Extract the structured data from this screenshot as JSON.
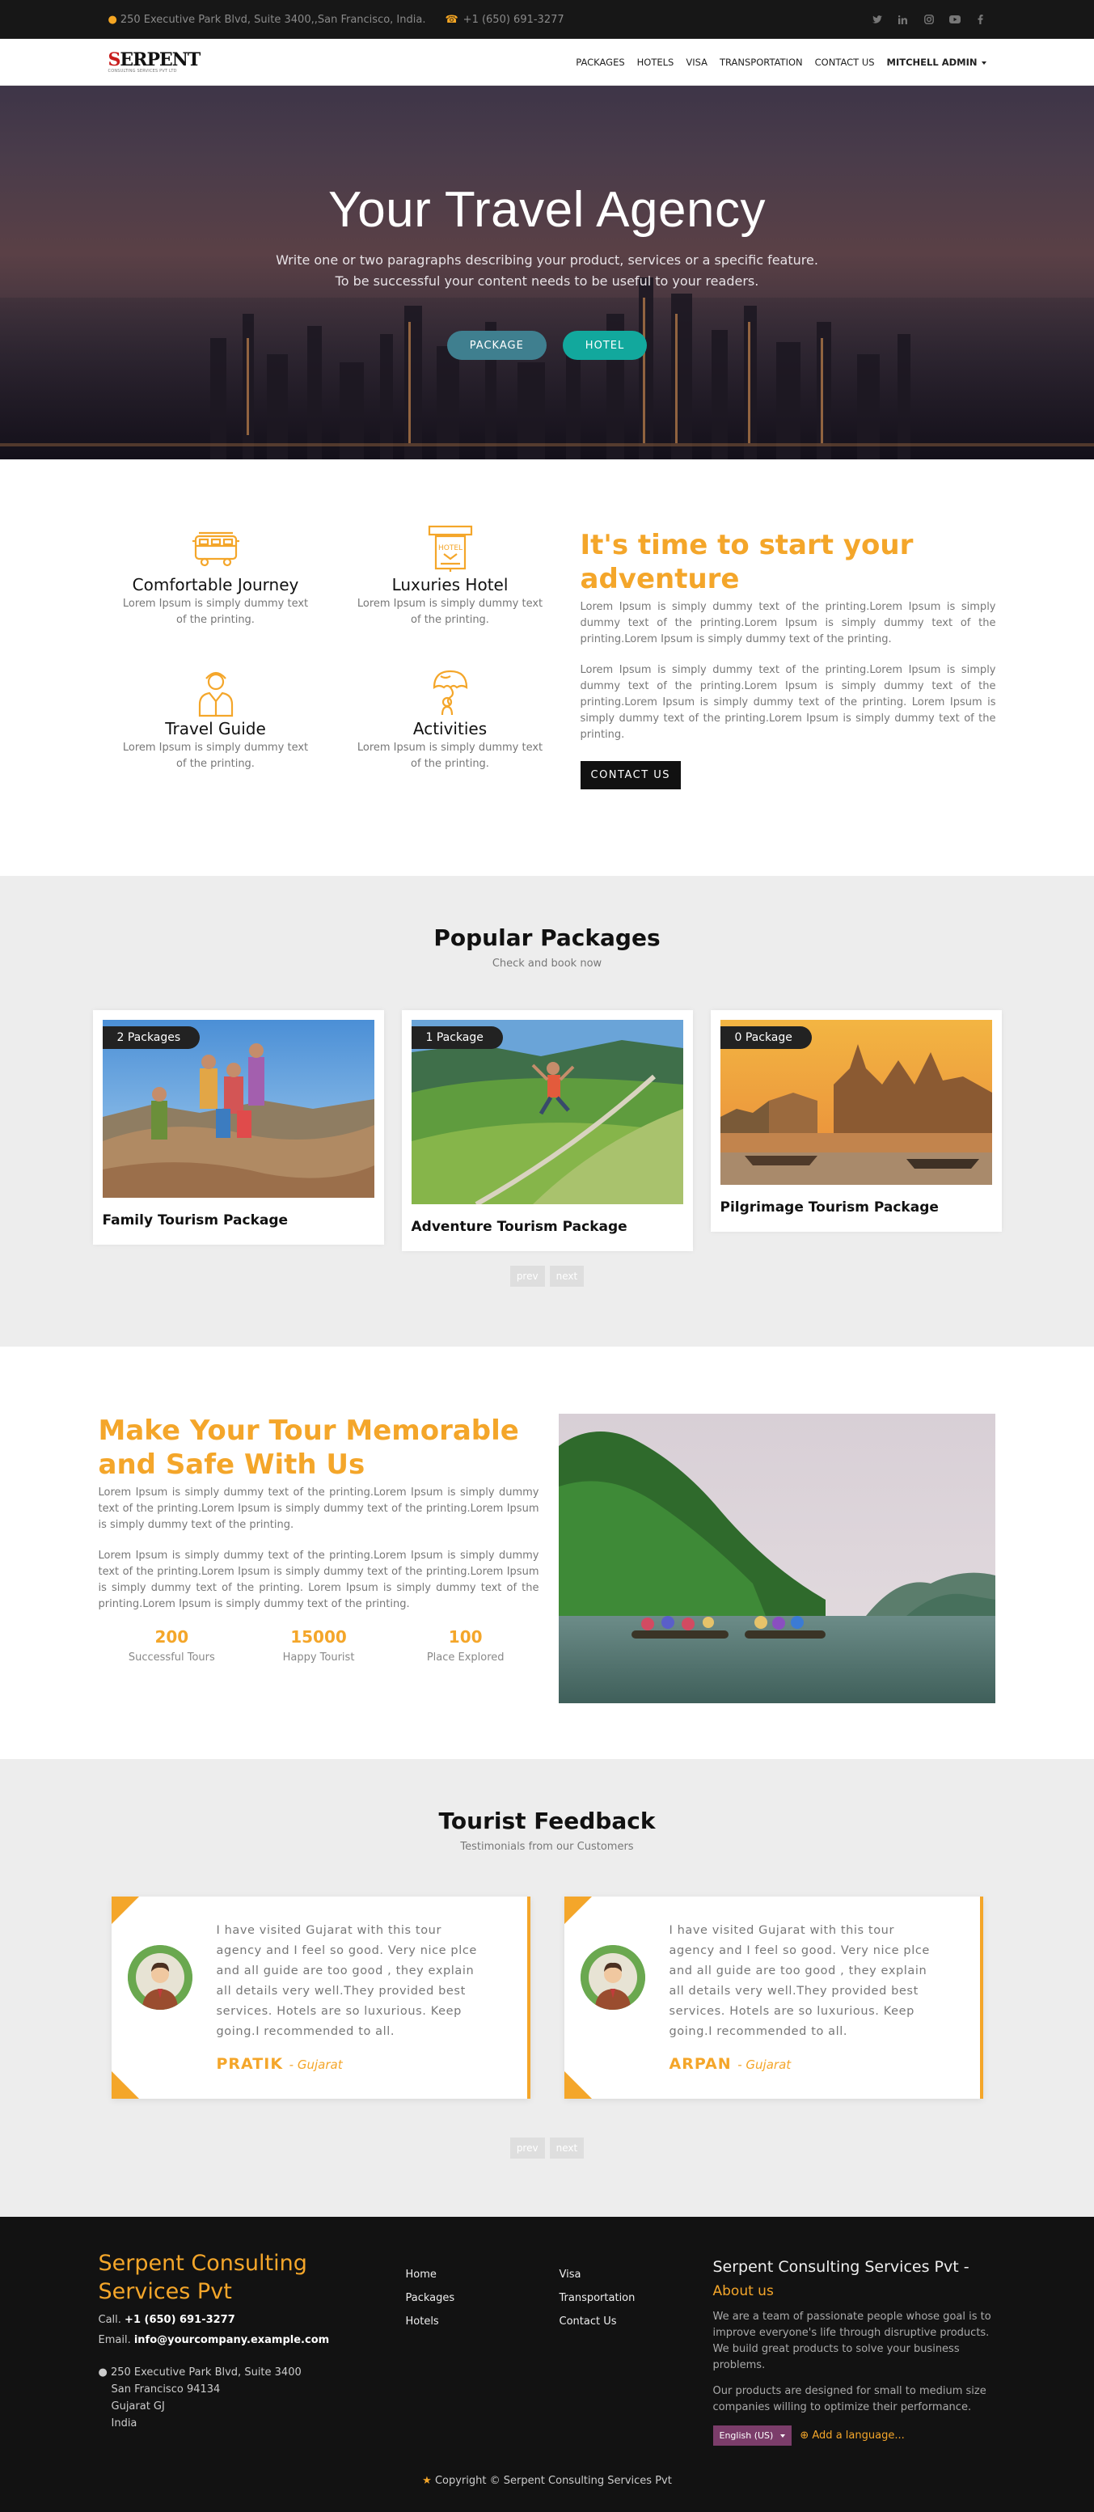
{
  "topbar": {
    "address": "250 Executive Park Blvd, Suite 3400,,San Francisco, India.",
    "phone": "+1 (650) 691-3277"
  },
  "navbar": {
    "logo_text": "SERPENT",
    "logo_sub": "CONSULTING SERVICES PVT LTD",
    "items": [
      "PACKAGES",
      "HOTELS",
      "VISA",
      "TRANSPORTATION",
      "CONTACT US"
    ],
    "user": "MITCHELL ADMIN"
  },
  "hero": {
    "title": "Your Travel Agency",
    "line1": "Write one or two paragraphs describing your product, services or a specific feature.",
    "line2": "To be successful your content needs to be useful to your readers.",
    "btn_package": "PACKAGE",
    "btn_hotel": "HOTEL"
  },
  "features": [
    {
      "title": "Comfortable Journey",
      "desc": "Lorem Ipsum is simply dummy text of the printing.",
      "icon": "bus-icon"
    },
    {
      "title": "Luxuries Hotel",
      "desc": "Lorem Ipsum is simply dummy text of the printing.",
      "icon": "hotel-icon"
    },
    {
      "title": "Travel Guide",
      "desc": "Lorem Ipsum is simply dummy text of the printing.",
      "icon": "guide-icon"
    },
    {
      "title": "Activities",
      "desc": "Lorem Ipsum is simply dummy text of the printing.",
      "icon": "balloon-icon"
    }
  ],
  "adventure": {
    "title": "It's time to start your adventure",
    "p1": "Lorem Ipsum is simply dummy text of the printing.Lorem Ipsum is simply dummy text of the printing.Lorem Ipsum is simply dummy text of the printing.Lorem Ipsum is simply dummy text of the printing.",
    "p2": "Lorem Ipsum is simply dummy text of the printing.Lorem Ipsum is simply dummy text of the printing.Lorem Ipsum is simply dummy text of the printing.Lorem Ipsum is simply dummy text of the printing. Lorem Ipsum is simply dummy text of the printing.Lorem Ipsum is simply dummy text of the printing.",
    "button": "CONTACT US"
  },
  "packages": {
    "title": "Popular Packages",
    "subtitle": "Check and book now",
    "items": [
      {
        "badge": "2 Packages",
        "name": "Family Tourism Package"
      },
      {
        "badge": "1 Package",
        "name": "Adventure Tourism Package"
      },
      {
        "badge": "0 Package",
        "name": "Pilgrimage Tourism Package"
      }
    ],
    "prev": "prev",
    "next": "next"
  },
  "memorable": {
    "title": "Make Your Tour Memorable and Safe With Us",
    "p1": "Lorem Ipsum is simply dummy text of the printing.Lorem Ipsum is simply dummy text of the printing.Lorem Ipsum is simply dummy text of the printing.Lorem Ipsum is simply dummy text of the printing.",
    "p2": "Lorem Ipsum is simply dummy text of the printing.Lorem Ipsum is simply dummy text of the printing.Lorem Ipsum is simply dummy text of the printing.Lorem Ipsum is simply dummy text of the printing. Lorem Ipsum is simply dummy text of the printing.Lorem Ipsum is simply dummy text of the printing.",
    "stats": [
      {
        "value": "200",
        "label": "Successful Tours"
      },
      {
        "value": "15000",
        "label": "Happy Tourist"
      },
      {
        "value": "100",
        "label": "Place Explored"
      }
    ]
  },
  "feedback": {
    "title": "Tourist Feedback",
    "subtitle": "Testimonials from our Customers",
    "items": [
      {
        "text": "I have visited Gujarat with this tour agency and I feel so good. Very nice plce and all guide are too good , they explain all details very well.They provided best services. Hotels are so luxurious. Keep going.I recommended to all.",
        "name": "PRATIK",
        "place": "- Gujarat"
      },
      {
        "text": "I have visited Gujarat with this tour agency and I feel so good. Very nice plce and all guide are too good , they explain all details very well.They provided best services. Hotels are so luxurious. Keep going.I recommended to all.",
        "name": "ARPAN",
        "place": "- Gujarat"
      }
    ],
    "prev": "prev",
    "next": "next"
  },
  "footer": {
    "company": "Serpent Consulting Services Pvt",
    "call_label": "Call.",
    "call": "+1 (650) 691-3277",
    "email_label": "Email.",
    "email": "info@yourcompany.example.com",
    "address": [
      "250 Executive Park Blvd, Suite 3400",
      "San Francisco 94134",
      "Gujarat GJ",
      "India"
    ],
    "links1": [
      "Home",
      "Packages",
      "Hotels"
    ],
    "links2": [
      "Visa",
      "Transportation",
      "Contact Us"
    ],
    "about_company": "Serpent Consulting Services Pvt -",
    "about_label": "About us",
    "about_p1": "We are a team of passionate people whose goal is to improve everyone's life through disruptive products. We build great products to solve your business problems.",
    "about_p2": "Our products are designed for small to medium size companies willing to optimize their performance.",
    "language": "English (US)",
    "add_language": "Add a language...",
    "copyright": "Copyright © Serpent Consulting Services Pvt"
  },
  "colors": {
    "accent": "#f4a62a",
    "dark": "#171717",
    "teal": "#12a89d"
  }
}
